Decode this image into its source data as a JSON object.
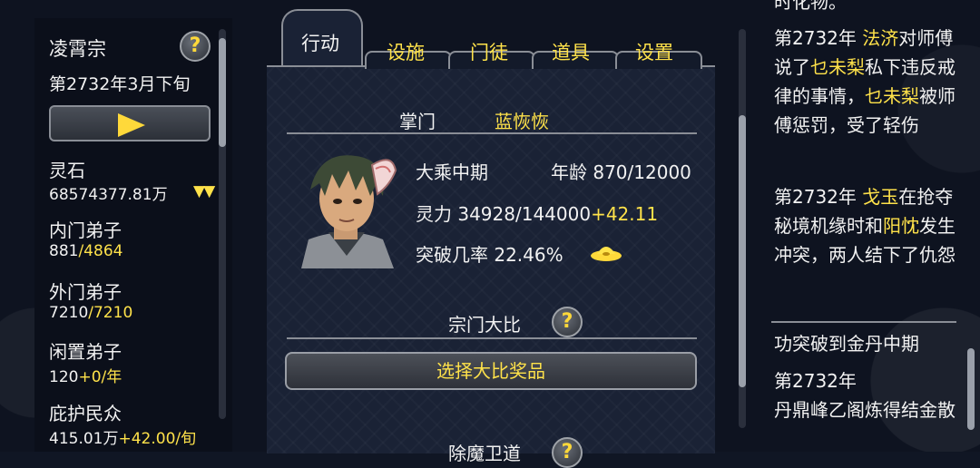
{
  "left": {
    "sect_name": "凌霄宗",
    "date": "第2732年3月下旬",
    "stats": [
      {
        "label": "灵石",
        "value": "68574377.81万",
        "extra": ""
      },
      {
        "label": "内门弟子",
        "value": "881",
        "extra": "/4864"
      },
      {
        "label": "外门弟子",
        "value": "7210",
        "extra": "/7210"
      },
      {
        "label": "闲置弟子",
        "value": "120",
        "extra": "+0/年"
      },
      {
        "label": "庇护民众",
        "value": "415.01万",
        "extra": "+42.00/旬"
      }
    ],
    "down_arrows": "▼▼",
    "help": "?"
  },
  "tabs": {
    "active": "行动",
    "others": [
      "设施",
      "门徒",
      "道具",
      "设置"
    ]
  },
  "leader": {
    "title_label": "掌门",
    "name": "蓝恢恢",
    "realm": "大乘中期",
    "age_label": "年龄",
    "age_value": "870/12000",
    "power_label": "灵力",
    "power_value": "34928/144000",
    "power_gain": "+42.11",
    "breakthrough_label": "突破几率",
    "breakthrough_value": "22.46%"
  },
  "competition": {
    "title": "宗门大比",
    "button": "选择大比奖品",
    "next_title": "除魔卫道"
  },
  "log": {
    "top_cut": "时化物。",
    "entry1": {
      "year": "第2732年",
      "name1": "法济",
      "t1": "对师傅说了",
      "name2": "乜未梨",
      "t2": "私下违反戒律的事情，",
      "name3": "乜未梨",
      "t3": "被师傅惩罚，受了轻伤"
    },
    "entry2": {
      "year": "第2732年",
      "name1": "戈玉",
      "t1": "在抢夺秘境机缘时和",
      "name2": "阳忱",
      "t2": "发生冲突，两人结下了仇怨"
    },
    "entry3": "功突破到金丹中期",
    "entry4": {
      "year": "第2732年",
      "text": "丹鼎峰乙阁炼得结金散"
    }
  },
  "colors": {
    "accent": "#ffe24a",
    "panel": "#1a2235",
    "border": "#8a8e96"
  }
}
